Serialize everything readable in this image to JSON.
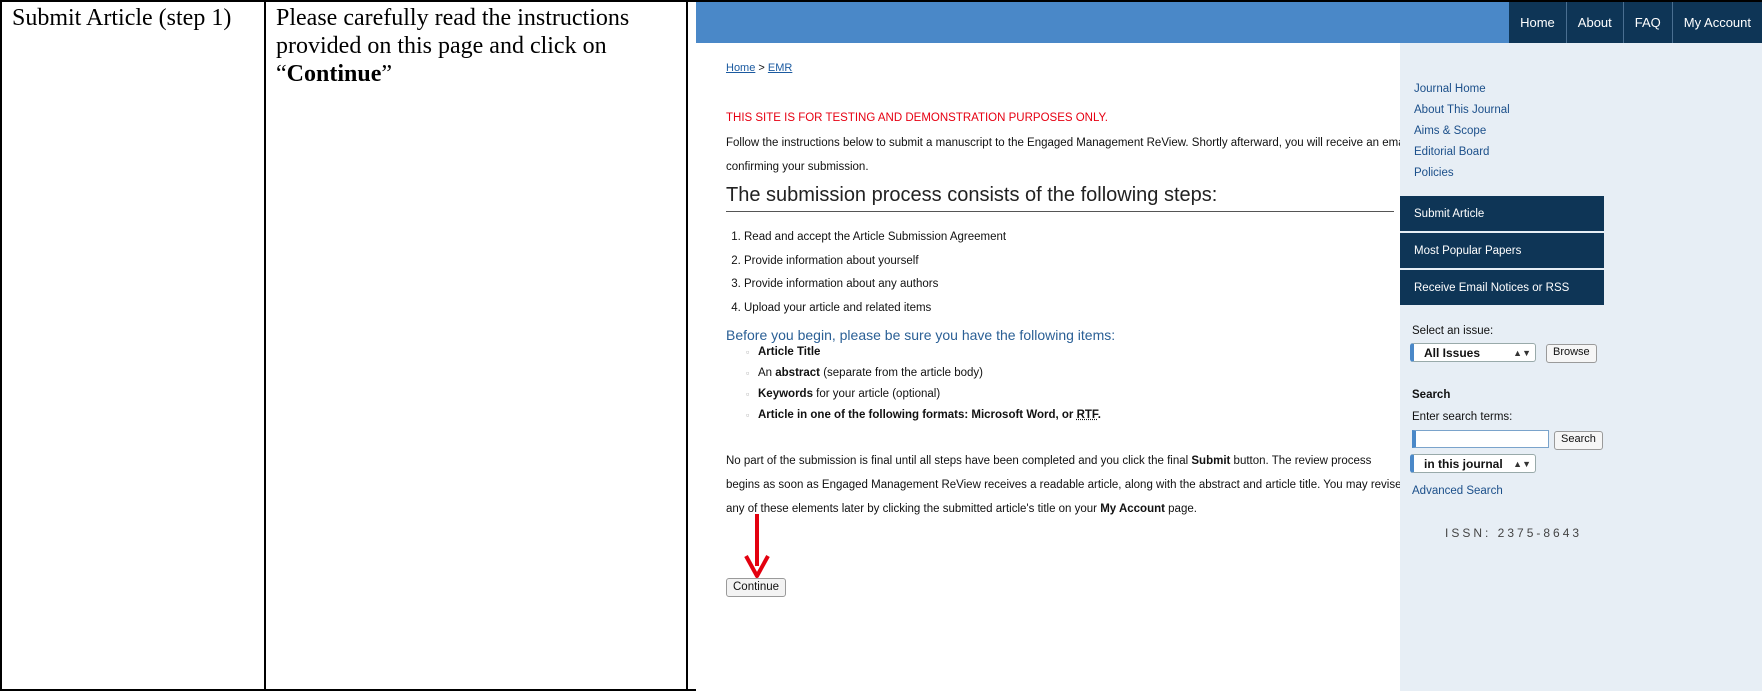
{
  "table": {
    "step_label": "Submit Article (step 1)",
    "instruction_prefix": "Please carefully read the instructions provided on this page and click on “",
    "instruction_bold": "Continue",
    "instruction_suffix": "”"
  },
  "nav": {
    "home": "Home",
    "about": "About",
    "faq": "FAQ",
    "my_account": "My Account"
  },
  "breadcrumb": {
    "home": "Home",
    "sep": " > ",
    "emr": "EMR"
  },
  "warning": "THIS SITE IS FOR TESTING AND DEMONSTRATION PURPOSES ONLY.",
  "intro": "Follow the instructions below to submit a manuscript to the Engaged Management ReView. Shortly afterward, you will receive an email confirming your submission.",
  "steps_heading": "The submission process consists of the following steps:",
  "steps": [
    "Read and accept the Article Submission Agreement",
    "Provide information about yourself",
    "Provide information about any authors",
    "Upload your article and related items"
  ],
  "before_heading": "Before you begin, please be sure you have the following items:",
  "items": {
    "title": "Article Title",
    "abstract_pre": "An ",
    "abstract_bold": "abstract",
    "abstract_post": " (separate from the article body)",
    "keywords_bold": "Keywords",
    "keywords_post": " for your article (optional)",
    "formats_pre": "Article in one of the following formats: Microsoft Word, or ",
    "formats_rtf": "RTF",
    "formats_post": "."
  },
  "final": {
    "pre": "No part of the submission is final until all steps have been completed and you click the final ",
    "submit": "Submit",
    "mid": " button. The review process begins as soon as Engaged Management ReView receives a readable article, along with the abstract and article title. You may revise any of these elements later by clicking the submitted article's title on your ",
    "account": "My Account",
    "post": " page."
  },
  "continue_label": "Continue",
  "sidebar": {
    "links": [
      "Journal Home",
      "About This Journal",
      "Aims & Scope",
      "Editorial Board",
      "Policies"
    ],
    "blocks": [
      "Submit Article",
      "Most Popular Papers",
      "Receive Email Notices or RSS"
    ],
    "select_issue_label": "Select an issue:",
    "issue_value": "All Issues",
    "browse_label": "Browse",
    "search_heading": "Search",
    "search_terms_label": "Enter search terms:",
    "search_button": "Search",
    "scope_value": "in this journal",
    "advanced_search": "Advanced Search",
    "issn": "ISSN: 2375-8643"
  },
  "colors": {
    "top_bar": "#4a88c8",
    "nav_dark": "#0e3556",
    "warning_red": "#e60012",
    "arrow_red": "#e3000f"
  },
  "icons": {
    "select_arrows": "updown-arrows-icon",
    "pointer": "down-arrow-icon"
  }
}
